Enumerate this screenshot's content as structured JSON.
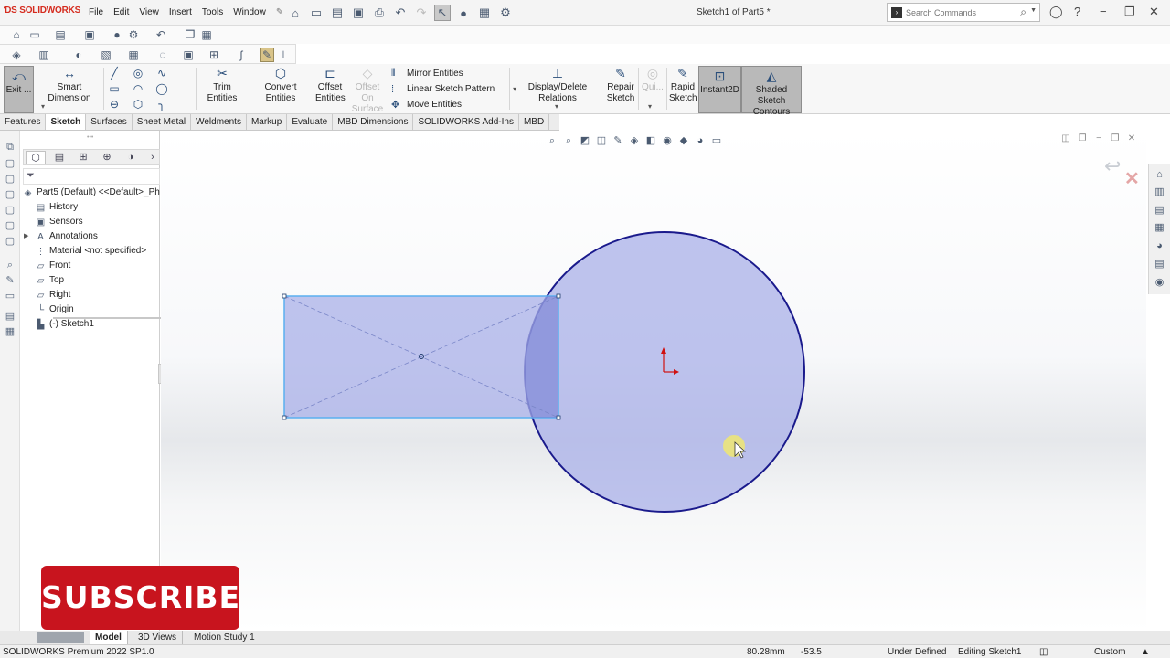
{
  "app": {
    "logo": "SOLIDWORKS",
    "document_title": "Sketch1 of Part5 *"
  },
  "menu": [
    "File",
    "Edit",
    "View",
    "Insert",
    "Tools",
    "Window"
  ],
  "search": {
    "placeholder": "Search Commands"
  },
  "commands": {
    "exit_sketch": "Exit ...",
    "smart_dimension": "Smart Dimension",
    "trim_entities": "Trim Entities",
    "convert_entities": "Convert Entities",
    "offset_entities_1": "Offset",
    "offset_entities_2": "Entities",
    "offset_on_surface_1": "Offset On",
    "offset_on_surface_2": "Surface",
    "mirror_entities": "Mirror Entities",
    "linear_sketch_pattern": "Linear Sketch Pattern",
    "move_entities": "Move Entities",
    "display_delete_relations": "Display/Delete Relations",
    "repair_sketch_1": "Repair",
    "repair_sketch_2": "Sketch",
    "quick_snaps": "Qui...",
    "rapid_sketch_1": "Rapid",
    "rapid_sketch_2": "Sketch",
    "instant2d": "Instant2D",
    "shaded_contours_1": "Shaded Sketch",
    "shaded_contours_2": "Contours"
  },
  "tabs": [
    "Features",
    "Sketch",
    "Surfaces",
    "Sheet Metal",
    "Weldments",
    "Markup",
    "Evaluate",
    "MBD Dimensions",
    "SOLIDWORKS Add-Ins",
    "MBD"
  ],
  "active_tab": "Sketch",
  "tree": {
    "root": "Part5 (Default) <<Default>_Ph",
    "items": [
      {
        "label": "History",
        "icon": "history-icon"
      },
      {
        "label": "Sensors",
        "icon": "sensors-icon"
      },
      {
        "label": "Annotations",
        "icon": "annotations-icon"
      },
      {
        "label": "Material <not specified>",
        "icon": "material-icon"
      },
      {
        "label": "Front",
        "icon": "plane-icon"
      },
      {
        "label": "Top",
        "icon": "plane-icon"
      },
      {
        "label": "Right",
        "icon": "plane-icon"
      },
      {
        "label": "Origin",
        "icon": "origin-icon"
      },
      {
        "label": "(-) Sketch1",
        "icon": "sketch-icon"
      }
    ]
  },
  "overlay": {
    "subscribe": "SUBSCRIBE"
  },
  "bottom_tabs": [
    "Model",
    "3D Views",
    "Motion Study 1"
  ],
  "active_bottom_tab": "Model",
  "status": {
    "product": "SOLIDWORKS Premium 2022 SP1.0",
    "x": "80.28mm",
    "y": "-53.5",
    "state": "Under Defined",
    "mode": "Editing Sketch1",
    "units": "Custom"
  },
  "colors": {
    "sketch_fill": "#a9b0e8",
    "circle_edge": "#1a1a8c",
    "rect_edge": "#5ab0f0",
    "brand_red": "#c8141e"
  }
}
